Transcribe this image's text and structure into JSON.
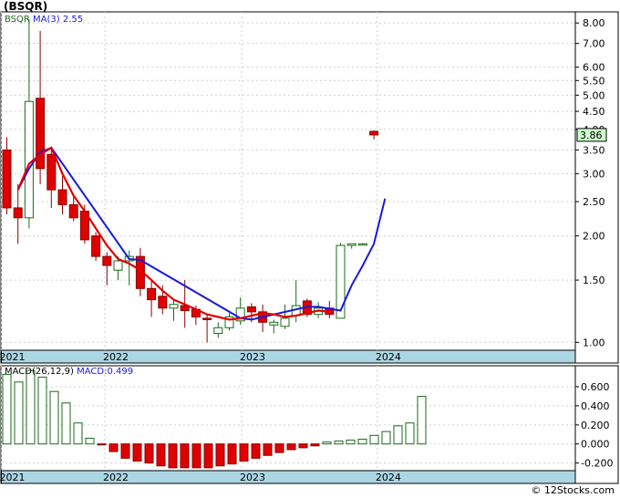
{
  "title": "(BSQR)",
  "legend_price": {
    "symbol": "BSQR",
    "ma_label": "MA(3)",
    "ma_value": "2.55"
  },
  "legend_macd": {
    "label": "MACD(26,12,9)",
    "name": "MACD:",
    "value": "0.499"
  },
  "footer": "© 12Stocks.com",
  "colors": {
    "up": "#1a6b1a",
    "down": "#e00000",
    "ma_red": "#e00000",
    "ma_blue": "#1a1ad6",
    "band": "#acd6e4",
    "last_price_bg": "#ccffcc"
  },
  "chart_data": [
    {
      "type": "candlestick",
      "scale": "log",
      "ylim": [
        0.95,
        8.6
      ],
      "yticks": [
        8.0,
        7.0,
        6.0,
        5.5,
        5.0,
        4.5,
        4.0,
        3.5,
        3.0,
        2.5,
        2.0,
        1.5,
        1.0
      ],
      "ytick_labels": [
        "8.00",
        "7.00",
        "6.00",
        "5.50",
        "5.00",
        "4.50",
        "4.00",
        "3.50",
        "3.00",
        "2.50",
        "2.00",
        "1.50",
        "1.00"
      ],
      "last_price": "3.86",
      "last_price_value": 3.86,
      "x_labels": [
        {
          "label": "2021",
          "i": 0
        },
        {
          "label": "2022",
          "i": 9.3
        },
        {
          "label": "2023",
          "i": 21.6
        },
        {
          "label": "2024",
          "i": 33.8
        }
      ],
      "candles": [
        {
          "o": 3.5,
          "h": 3.8,
          "l": 2.3,
          "c": 2.4
        },
        {
          "o": 2.4,
          "h": 2.8,
          "l": 1.9,
          "c": 2.25
        },
        {
          "o": 2.25,
          "h": 8.2,
          "l": 2.1,
          "c": 4.8
        },
        {
          "o": 4.9,
          "h": 7.6,
          "l": 2.8,
          "c": 3.1
        },
        {
          "o": 3.4,
          "h": 3.55,
          "l": 2.4,
          "c": 2.7
        },
        {
          "o": 2.7,
          "h": 2.95,
          "l": 2.3,
          "c": 2.45
        },
        {
          "o": 2.45,
          "h": 2.6,
          "l": 2.2,
          "c": 2.25
        },
        {
          "o": 2.35,
          "h": 2.45,
          "l": 1.9,
          "c": 1.95
        },
        {
          "o": 2.0,
          "h": 2.05,
          "l": 1.7,
          "c": 1.75
        },
        {
          "o": 1.75,
          "h": 1.8,
          "l": 1.45,
          "c": 1.65
        },
        {
          "o": 1.6,
          "h": 1.75,
          "l": 1.5,
          "c": 1.7
        },
        {
          "o": 1.7,
          "h": 1.82,
          "l": 1.45,
          "c": 1.75
        },
        {
          "o": 1.75,
          "h": 1.85,
          "l": 1.35,
          "c": 1.42
        },
        {
          "o": 1.42,
          "h": 1.5,
          "l": 1.18,
          "c": 1.32
        },
        {
          "o": 1.35,
          "h": 1.45,
          "l": 1.2,
          "c": 1.25
        },
        {
          "o": 1.25,
          "h": 1.32,
          "l": 1.15,
          "c": 1.28
        },
        {
          "o": 1.27,
          "h": 1.5,
          "l": 1.1,
          "c": 1.23
        },
        {
          "o": 1.24,
          "h": 1.27,
          "l": 1.12,
          "c": 1.18
        },
        {
          "o": 1.17,
          "h": 1.2,
          "l": 1.0,
          "c": 1.16
        },
        {
          "o": 1.06,
          "h": 1.14,
          "l": 1.03,
          "c": 1.1
        },
        {
          "o": 1.1,
          "h": 1.21,
          "l": 1.08,
          "c": 1.18
        },
        {
          "o": 1.15,
          "h": 1.34,
          "l": 1.12,
          "c": 1.25
        },
        {
          "o": 1.26,
          "h": 1.29,
          "l": 1.14,
          "c": 1.22
        },
        {
          "o": 1.22,
          "h": 1.28,
          "l": 1.07,
          "c": 1.14
        },
        {
          "o": 1.12,
          "h": 1.16,
          "l": 1.06,
          "c": 1.14
        },
        {
          "o": 1.11,
          "h": 1.28,
          "l": 1.09,
          "c": 1.17
        },
        {
          "o": 1.19,
          "h": 1.5,
          "l": 1.14,
          "c": 1.27
        },
        {
          "o": 1.31,
          "h": 1.33,
          "l": 1.18,
          "c": 1.2
        },
        {
          "o": 1.2,
          "h": 1.3,
          "l": 1.17,
          "c": 1.25
        },
        {
          "o": 1.25,
          "h": 1.31,
          "l": 1.17,
          "c": 1.2
        },
        {
          "o": 1.17,
          "h": 1.91,
          "l": 1.17,
          "c": 1.88
        },
        {
          "o": 1.88,
          "h": 1.9,
          "l": 1.84,
          "c": 1.9
        },
        {
          "o": 1.9,
          "h": 1.91,
          "l": 1.88,
          "c": 1.9
        },
        {
          "o": 3.95,
          "h": 3.98,
          "l": 3.75,
          "c": 3.86
        }
      ],
      "ma_red": [
        null,
        2.7,
        3.2,
        3.4,
        3.55,
        3.0,
        2.6,
        2.35,
        2.1,
        1.88,
        1.72,
        1.67,
        1.6,
        1.5,
        1.4,
        1.32,
        1.28,
        1.24,
        1.2,
        1.18,
        1.16,
        1.17,
        1.19,
        1.21,
        1.2,
        1.18,
        1.19,
        1.21,
        1.23,
        1.22
      ],
      "ma_blue_start": 1,
      "ma_blue": [
        2.7,
        3.1,
        3.45,
        3.55,
        null,
        null,
        null,
        null,
        null,
        null,
        1.72,
        1.71,
        null,
        null,
        null,
        null,
        null,
        null,
        null,
        null,
        1.17,
        1.16,
        null,
        null,
        null,
        null,
        1.26,
        1.26,
        null,
        1.23,
        1.45,
        1.65,
        1.9,
        2.55
      ]
    },
    {
      "type": "bar",
      "name": "MACD",
      "ylim": [
        -0.28,
        0.82
      ],
      "yticks": [
        0.6,
        0.4,
        0.2,
        0.0,
        -0.2
      ],
      "ytick_labels": [
        "0.600",
        "0.400",
        "0.200",
        "0.000",
        "-0.200"
      ],
      "x_labels": [
        {
          "label": "2021",
          "i": 0
        },
        {
          "label": "2022",
          "i": 9.3
        },
        {
          "label": "2023",
          "i": 21.6
        },
        {
          "label": "2024",
          "i": 33.8
        }
      ],
      "values": [
        0.73,
        0.65,
        0.77,
        0.7,
        0.55,
        0.43,
        0.22,
        0.06,
        -0.01,
        -0.08,
        -0.15,
        -0.18,
        -0.2,
        -0.23,
        -0.25,
        -0.25,
        -0.25,
        -0.25,
        -0.23,
        -0.21,
        -0.18,
        -0.15,
        -0.12,
        -0.09,
        -0.06,
        -0.04,
        -0.02,
        0.02,
        0.03,
        0.04,
        0.05,
        0.09,
        0.13,
        0.19,
        0.22,
        0.499
      ]
    }
  ]
}
